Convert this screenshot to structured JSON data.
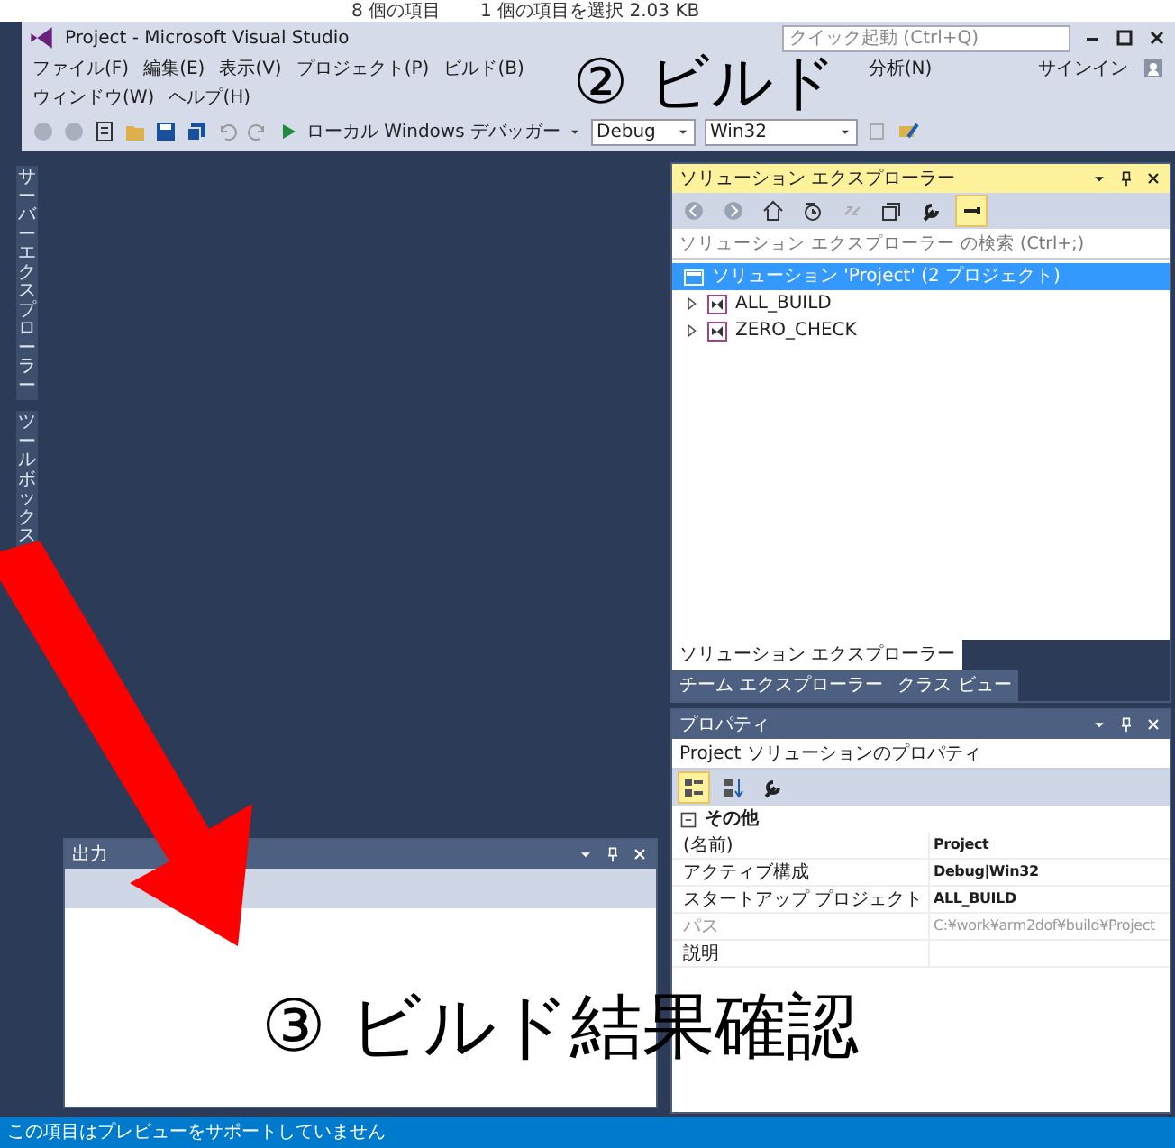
{
  "background_window": {
    "item_count": "8 個の項目",
    "selection": "1 個の項目を選択  2.03 KB"
  },
  "window": {
    "title": "Project - Microsoft Visual Studio",
    "quick_launch": {
      "placeholder": "クイック起動 (Ctrl+Q)"
    },
    "sign_in": "サインイン"
  },
  "menu_rows": [
    [
      "ファイル(F)",
      "編集(E)",
      "表示(V)",
      "プロジェクト(P)",
      "ビルド(B)"
    ],
    [
      "ウィンドウ(W)",
      "ヘルプ(H)"
    ]
  ],
  "menu_right": [
    "分析(N)"
  ],
  "toolbar": {
    "debugger": "ローカル Windows デバッガー",
    "configuration": "Debug",
    "platform": "Win32"
  },
  "side_tabs": [
    "サーバーエクスプローラー",
    "ツールボックス"
  ],
  "solution_explorer": {
    "title": "ソリューション エクスプローラー",
    "toolbar": [
      {
        "kind": "back",
        "selected": false
      },
      {
        "kind": "forward",
        "selected": false
      },
      {
        "kind": "home",
        "selected": false
      },
      {
        "kind": "pending",
        "selected": false
      },
      {
        "kind": "sync",
        "selected": false
      },
      {
        "kind": "collapse",
        "selected": false
      },
      {
        "kind": "wrench",
        "selected": false
      },
      {
        "kind": "preview",
        "selected": true
      }
    ],
    "search": {
      "placeholder": "ソリューション エクスプローラー の検索 (Ctrl+;)"
    },
    "tree": [
      {
        "label": "ソリューション 'Project' (2 プロジェクト)",
        "kind": "solution",
        "selected": true,
        "children": [
          {
            "label": "ALL_BUILD",
            "kind": "project",
            "selected": false,
            "expanded": false
          },
          {
            "label": "ZERO_CHECK",
            "kind": "project",
            "selected": false,
            "expanded": false
          }
        ]
      }
    ],
    "tabs": [
      {
        "label": "ソリューション エクスプローラー",
        "selected": true
      },
      {
        "label": "チーム エクスプローラー",
        "selected": false
      },
      {
        "label": "クラス ビュー",
        "selected": false
      }
    ]
  },
  "properties": {
    "title": "プロパティ",
    "object": "Project ソリューションのプロパティ",
    "toolbar": [
      {
        "kind": "categorized",
        "selected": true
      },
      {
        "kind": "alphabetical",
        "selected": false
      },
      {
        "kind": "wrench",
        "selected": false
      }
    ],
    "category": "その他",
    "expanded": true,
    "rows": [
      {
        "name": "(名前)",
        "value": "Project",
        "disabled": false
      },
      {
        "name": "アクティブ構成",
        "value": "Debug|Win32",
        "disabled": false
      },
      {
        "name": "スタートアップ プロジェクト",
        "value": "ALL_BUILD",
        "disabled": false
      },
      {
        "name": "パス",
        "value": "C:¥work¥arm2dof¥build¥Project",
        "disabled": true
      },
      {
        "name": "説明",
        "disabled": false
      }
    ]
  },
  "output": {
    "title": "出力"
  },
  "annotations": [
    {
      "text": "② ビルド"
    },
    {
      "text": "③ ビルド結果確認"
    }
  ],
  "status_bar": "この項目はプレビューをサポートしていません"
}
